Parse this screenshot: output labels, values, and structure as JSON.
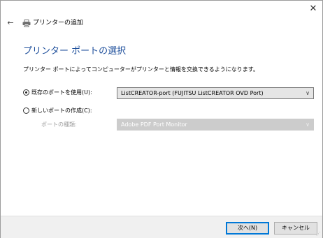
{
  "window": {
    "title": "プリンターの追加",
    "close_glyph": "✕",
    "back_glyph": "←"
  },
  "main": {
    "heading": "プリンター ポートの選択",
    "description": "プリンター ポートによってコンピューターがプリンターと情報を交換できるようになります。"
  },
  "options": {
    "existing_port": {
      "label": "既存のポートを使用(U):",
      "selected": true,
      "value": "ListCREATOR-port (FUJITSU ListCREATOR OVD Port)"
    },
    "new_port": {
      "label": "新しいポートの作成(C):",
      "selected": false,
      "type_label": "ポートの種類:",
      "type_value": "Adobe PDF Port Monitor"
    }
  },
  "footer": {
    "next_label": "次へ(N)",
    "cancel_label": "キャンセル"
  },
  "icons": {
    "chevron": "∨",
    "grip": "⋰"
  }
}
